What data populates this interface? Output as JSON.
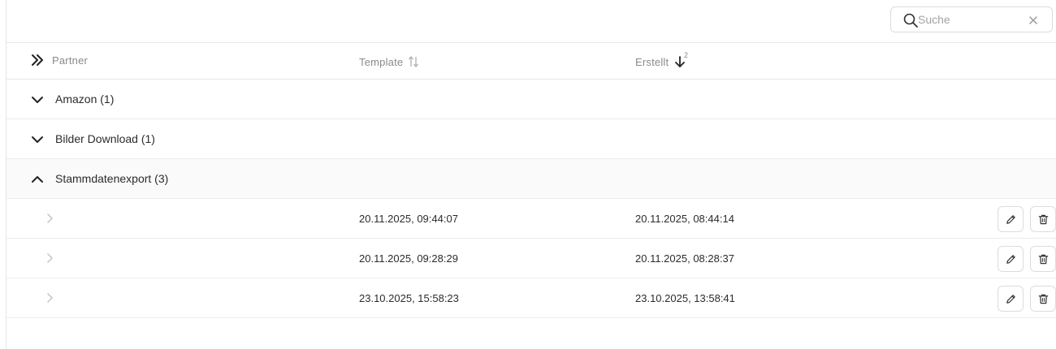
{
  "search": {
    "placeholder": "Suche",
    "value": ""
  },
  "table": {
    "columns": {
      "partner": "Partner",
      "template": "Template",
      "erstellt": "Erstellt",
      "erstellt_sort_rank": "2"
    },
    "groups": [
      {
        "label": "Amazon (1)",
        "expanded": false
      },
      {
        "label": "Bilder Download (1)",
        "expanded": false
      },
      {
        "label": "Stammdatenexport (3)",
        "expanded": true
      }
    ],
    "rows": [
      {
        "template": "20.11.2025, 09:44:07",
        "created": "20.11.2025, 08:44:14"
      },
      {
        "template": "20.11.2025, 09:28:29",
        "created": "20.11.2025, 08:28:37"
      },
      {
        "template": "23.10.2025, 15:58:23",
        "created": "23.10.2025, 13:58:41"
      }
    ]
  },
  "icons": {
    "search": "search-icon",
    "clear": "close-icon",
    "expand_all": "double-chevron-right-icon",
    "sort": "sort-updown-icon",
    "sort_desc": "arrow-down-icon",
    "collapse": "chevron-down-icon",
    "expand": "chevron-up-icon",
    "row_expand": "chevron-right-icon",
    "edit": "pencil-icon",
    "delete": "trash-icon"
  },
  "colors": {
    "text": "#2b2b2b",
    "muted": "#8a8a8a",
    "border": "#e8e8e8",
    "selected_group_bg": "#fafafa"
  }
}
